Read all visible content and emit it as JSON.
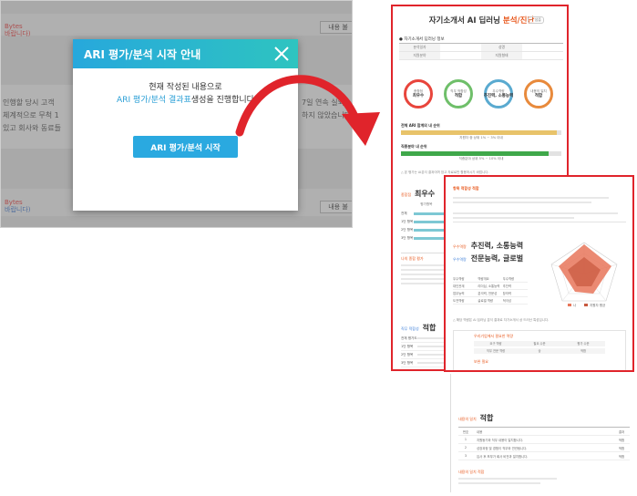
{
  "editor": {
    "bytes_label_1": "Bytes",
    "bytes_hint_1": "바랍니다)",
    "bytes_label_2": "Bytes",
    "bytes_hint_2": "바랍니다)",
    "load_button_label": "내용 불",
    "load_button_label_2": "내용 불",
    "text_line_1": "인행할 당시 고객",
    "text_line_1_right": "7일 연속 실외",
    "text_line_2": "체계적으로 무척 1",
    "text_line_2_right": "하지 않았습니다",
    "text_line_3": "있고 회사와 동료들"
  },
  "modal": {
    "title": "ARI 평가/분석 시작 안내",
    "body_line_1": "현재 작성된 내용으로",
    "body_line_2_highlight": "ARI 평가/분석 결과표",
    "body_line_2_rest": "생성을 진행합니다",
    "start_button": "ARI 평가/분석 시작"
  },
  "report_page1": {
    "title_main": "자기소개서 AI 딥러닝",
    "title_accent": "분석/진단",
    "badge": "~ 샘플",
    "section_caption": "● 자기소개서 딥러닝 정보",
    "info_rows": [
      [
        "분석일자",
        "",
        "성명",
        ""
      ],
      [
        "지원분야",
        "",
        "지원형태",
        ""
      ]
    ],
    "circles": [
      {
        "title": "종합점",
        "value": "최우수",
        "color": "#e8453c"
      },
      {
        "title": "직무 적합성",
        "value": "적합",
        "color": "#6fbf6a"
      },
      {
        "title": "우수역량",
        "value": "추진력, 소통능력",
        "color": "#5aaad0"
      },
      {
        "title": "내용의 일치",
        "value": "적합",
        "color": "#e88a3c"
      }
    ],
    "bar1_label": "전체 ARI 합계의 내 순위",
    "bar1_fill_fraction": 0.97,
    "bar1_note": "지원자 중 상위 1% ~ 3% 이내",
    "bar2_label": "직종분야 내 순위",
    "bar2_fill_fraction": 0.92,
    "bar2_note": "직종분야 상위 5% ~ 10% 이내",
    "warning": "△ 본 평가는 AI분석 결과이며 참고 자료로만 활용하시기 바랍니다.",
    "section2_kicker": "종합점",
    "section2_title": "최우수",
    "mini_head": [
      "평가항목",
      "점수",
      "평균"
    ],
    "mini_rows": [
      {
        "label": "전체",
        "fraction": 0.95
      },
      {
        "label": "1단 항목",
        "fraction": 0.82
      },
      {
        "label": "2단 항목",
        "fraction": 0.88
      },
      {
        "label": "3단 항목",
        "fraction": 0.78
      }
    ],
    "result_title": "나의 종합 평가",
    "fit_kicker": "직무 적합성",
    "fit_title": "적합",
    "fit_rows": [
      "전체 평가도",
      "1단 항목",
      "2단 항목",
      "3단 항목"
    ]
  },
  "report_page2": {
    "strength_heading": "항목 적합성 적합",
    "dim_rows": [
      {
        "kicker": "우수역량",
        "value": "추진력, 소통능력",
        "kicker_color": "#e8591e"
      },
      {
        "kicker": "우수역량",
        "value": "전문능력, 글로벌",
        "kicker_color": "#3b7dd8"
      }
    ],
    "dim_table": [
      [
        "우수역량",
        "역량개요",
        "우수역량"
      ],
      [
        "대인관계",
        "리더십, 소통능력",
        "추진력"
      ],
      [
        "업무능력",
        "분석력, 전문성",
        "창의력"
      ],
      [
        "도전역량",
        "글로벌 역량",
        "적극성"
      ]
    ],
    "radar_legend": [
      "나",
      "지원자 평균"
    ],
    "note": "△ 해당 역량은 AI 딥러닝 분석 결과로 자기소개서 상 드러난 특성입니다.",
    "box_title": "우리기업에서 필요한 역량",
    "box_title_2": "보완 필요",
    "box_rows": [
      [
        "요구 역량",
        "필요 수준",
        "평가 수준"
      ],
      [
        "직무 전문 역량",
        "상",
        "적합"
      ]
    ]
  },
  "report_page3": {
    "kicker": "내용의 일치",
    "title": "적합",
    "rows": [
      [
        "번호",
        "내용",
        "결과"
      ],
      [
        "1",
        "지원동기와 직무 내용이 일치합니다.",
        "적합"
      ],
      [
        "2",
        "성장과정 및 경험이 직무와 연관됩니다.",
        "적합"
      ],
      [
        "3",
        "입사 후 포부가 회사 비전과 일치합니다.",
        "적합"
      ]
    ],
    "kicker2": "내용의 일치 적합"
  },
  "colors": {
    "modal_header_start": "#27a8dc",
    "modal_header_end": "#2ec4c0",
    "accent_orange": "#e8591e",
    "page_border": "#e0242b",
    "arrow": "#e0242b",
    "bar1": "#e8c36a",
    "bar2": "#3fa84a"
  }
}
